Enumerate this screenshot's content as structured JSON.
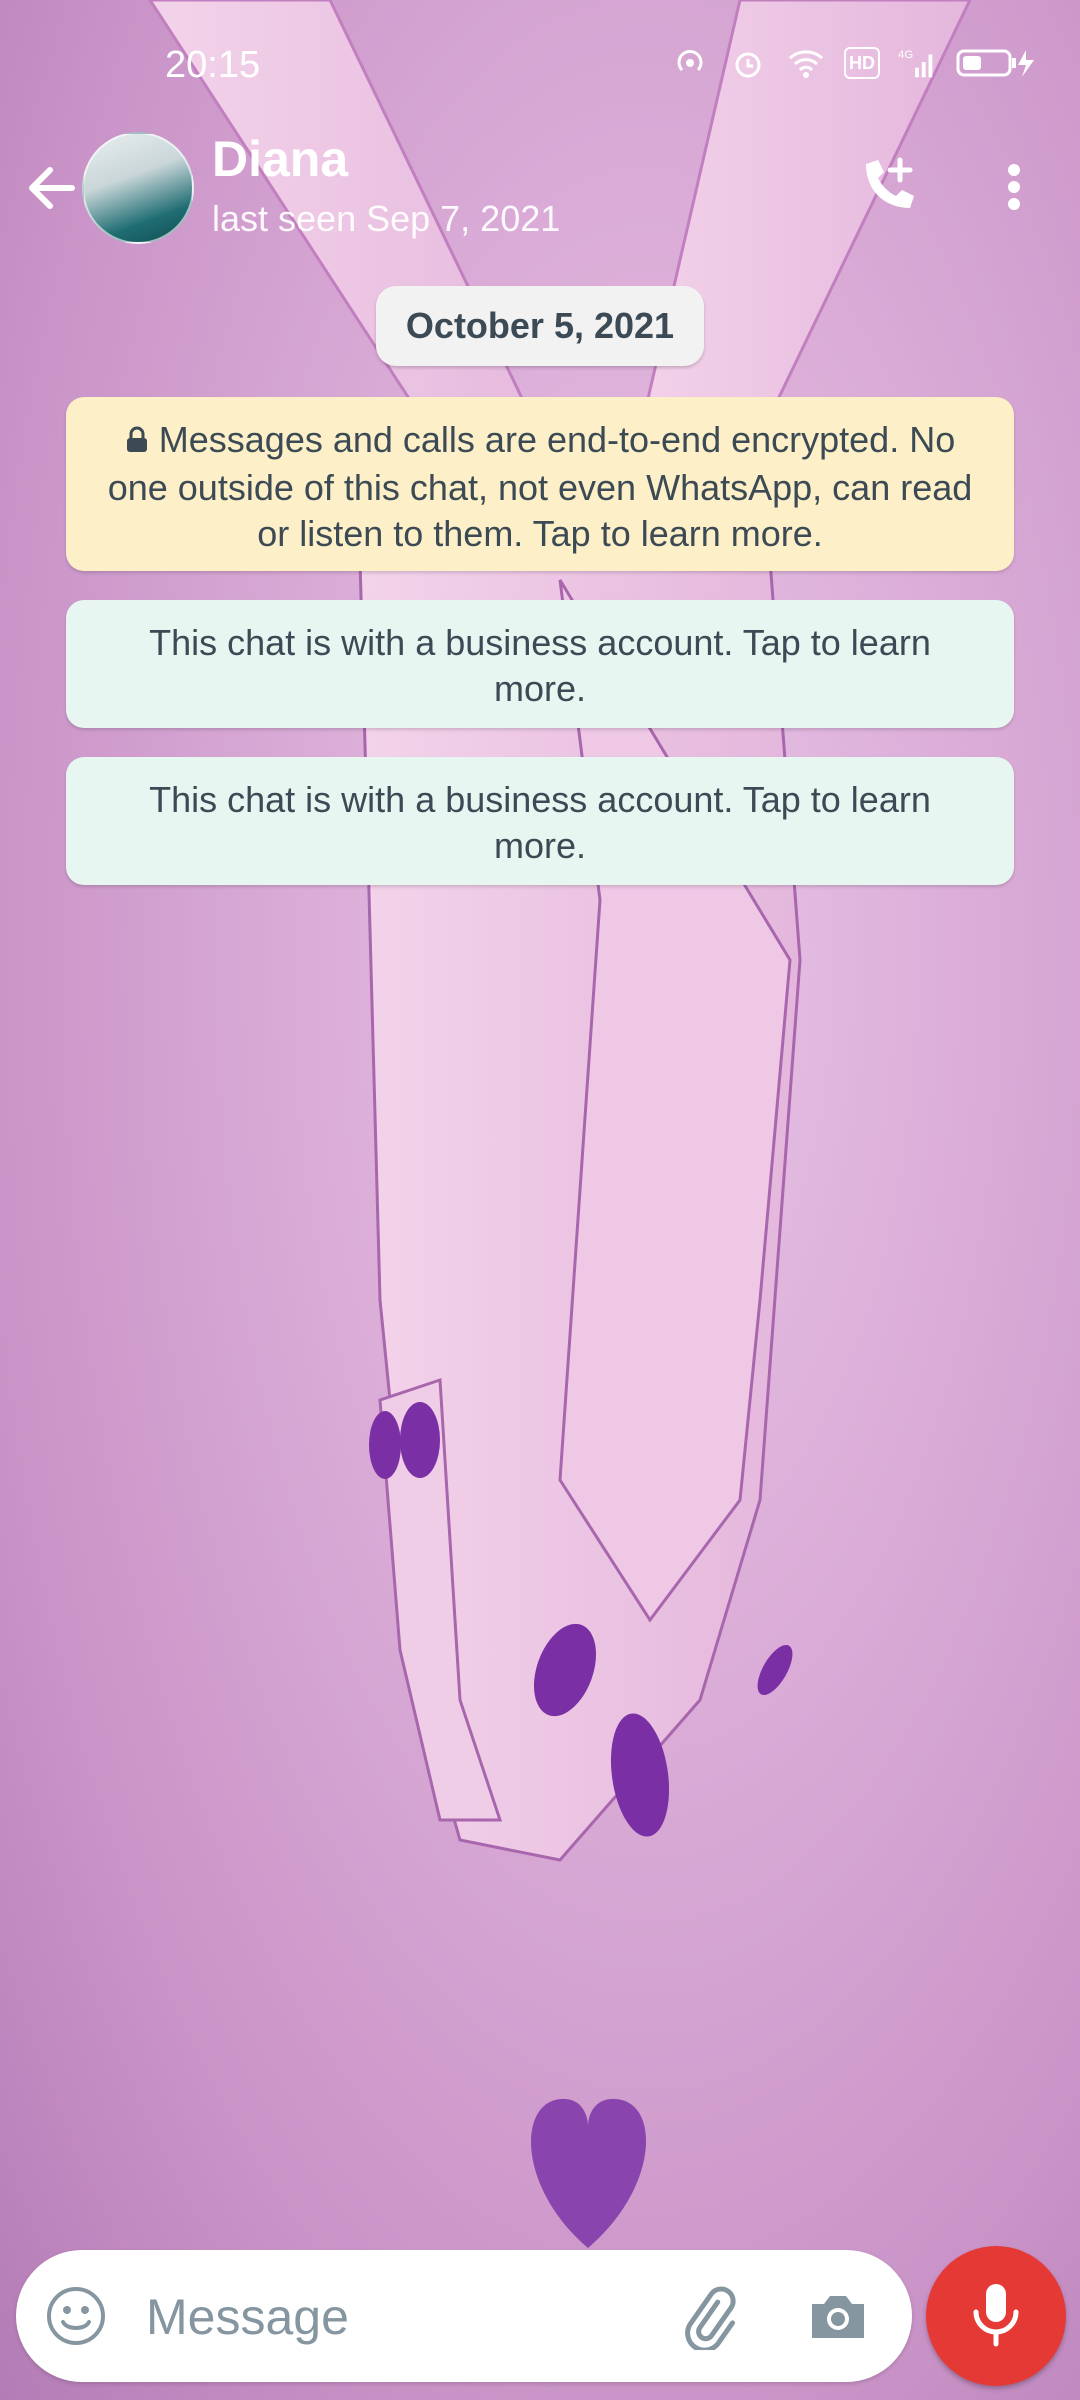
{
  "status_bar": {
    "time": "20:15",
    "icons": [
      "hotspot-icon",
      "alarm-icon",
      "wifi-icon",
      "hd-icon",
      "signal-4g-icon",
      "battery-charging-icon"
    ],
    "hd_label": "HD",
    "network_label": "4G"
  },
  "header": {
    "contact_name": "Diana",
    "last_seen": "last seen Sep 7, 2021",
    "icons": [
      "back-arrow-icon",
      "add-call-icon",
      "more-vert-icon"
    ]
  },
  "chat": {
    "date_chip": "October 5, 2021",
    "encryption_notice": "Messages and calls are end-to-end encrypted. No one outside of this chat, not even WhatsApp, can read or listen to them. Tap to learn more.",
    "business_notices": [
      "This chat is with a business account. Tap to learn more.",
      "This chat is with a business account. Tap to learn more."
    ]
  },
  "composer": {
    "placeholder": "Message",
    "value": "",
    "icons": [
      "emoji-icon",
      "attach-icon",
      "camera-icon",
      "mic-icon"
    ]
  },
  "colors": {
    "notice_encryption_bg": "#fdefc7",
    "notice_business_bg": "#e7f6f1",
    "mic_button": "#e53935",
    "wallpaper_base": "#d9aad6",
    "nail_polish": "#7a2fa5"
  }
}
